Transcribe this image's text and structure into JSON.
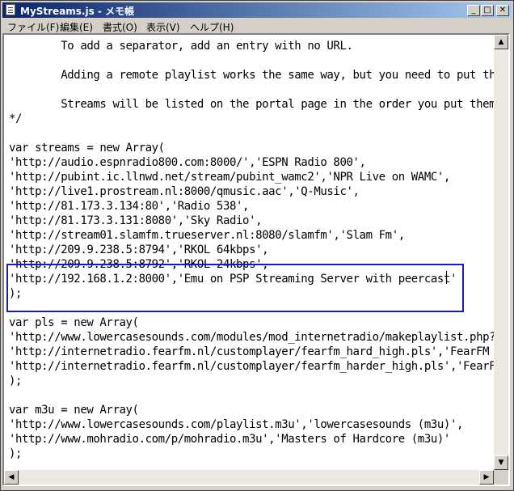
{
  "window": {
    "title": "MyStreams.js - メモ帳",
    "controls": {
      "minimize": "_",
      "maximize": "□",
      "close": "✕"
    }
  },
  "menu": [
    "ファイル(F)",
    "編集(E)",
    "書式(O)",
    "表示(V)",
    "ヘルプ(H)"
  ],
  "editor": {
    "lines": [
      "        To add a separator, add an entry with no URL.",
      "",
      "        Adding a remote playlist works the same way, but you need to put the",
      "",
      "        Streams will be listed on the portal page in the order you put them",
      "*/",
      "",
      "var streams = new Array(",
      "'http://audio.espnradio800.com:8000/','ESPN Radio 800',",
      "'http://pubint.ic.llnwd.net/stream/pubint_wamc2','NPR Live on WAMC',",
      "'http://live1.prostream.nl:8000/qmusic.aac','Q-Music',",
      "'http://81.173.3.134:80','Radio 538',",
      "'http://81.173.3.131:8080','Sky Radio',",
      "'http://stream01.slamfm.trueserver.nl:8080/slamfm','Slam Fm',",
      "'http://209.9.238.5:8794','RKOL 64kbps',",
      "'http://209.9.238.5:8792','RKOL 24kbps',",
      "'http://192.168.1.2:8000','Emu on PSP Streaming Server with peercast'",
      ");",
      "",
      "var pls = new Array(",
      "'http://www.lowercasesounds.com/modules/mod_internetradio/makeplaylist.php?i",
      "'http://internetradio.fearfm.nl/customplayer/fearfm_hard_high.pls','FearFM H",
      "'http://internetradio.fearfm.nl/customplayer/fearfm_harder_high.pls','FearFM",
      ");",
      "",
      "var m3u = new Array(",
      "'http://www.lowercasesounds.com/playlist.m3u','lowercasesounds (m3u)',",
      "'http://www.mohradio.com/p/mohradio.m3u','Masters of Hardcore (m3u)'",
      ");"
    ]
  },
  "scrollbar": {
    "up": "▲",
    "down": "▼",
    "left": "◀",
    "right": "▶"
  },
  "highlight_color": "#1818c8"
}
